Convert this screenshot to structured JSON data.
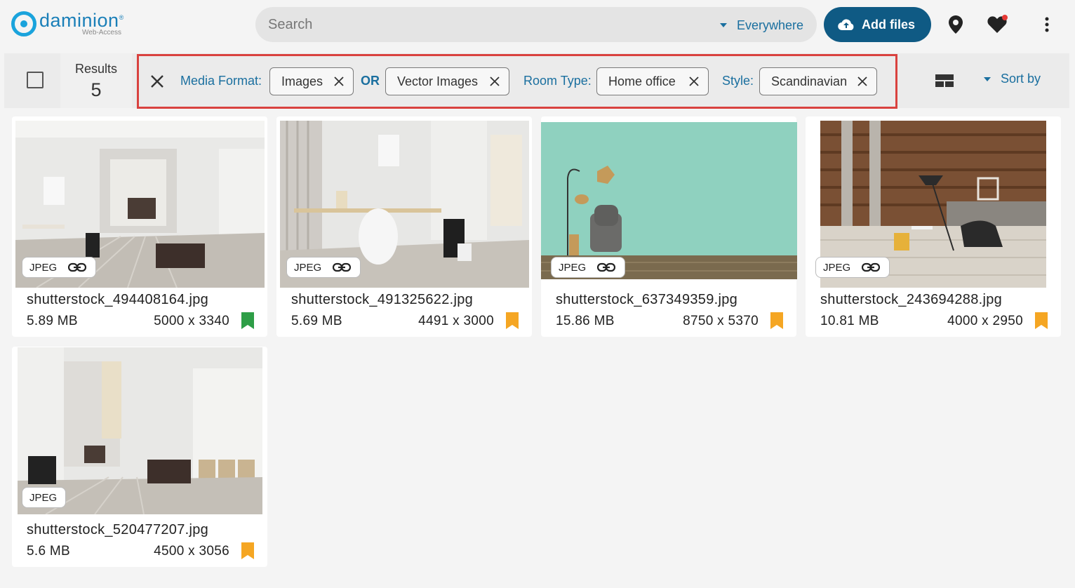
{
  "logo": {
    "name": "daminion",
    "sup": "®",
    "sub": "Web-Access"
  },
  "search": {
    "placeholder": "Search",
    "scope": "Everywhere"
  },
  "header": {
    "add_files": "Add files"
  },
  "toolbar": {
    "results_label": "Results",
    "results_count": "5",
    "sort_label": "Sort by"
  },
  "filters": {
    "media_format_label": "Media Format:",
    "chip1": "Images",
    "or_label": "OR",
    "chip2": "Vector Images",
    "room_type_label": "Room Type:",
    "chip3": "Home office",
    "style_label": "Style:",
    "chip4": "Scandinavian"
  },
  "colors": {
    "accent": "#1a6f9f",
    "primary_button": "#0f5a84",
    "highlight_border": "#d9423f",
    "bookmark_green": "#2e9e47",
    "bookmark_orange": "#f5a623"
  },
  "items": [
    {
      "name": "shutterstock_494408164.jpg",
      "size": "5.89 MB",
      "dims": "5000 x 3340",
      "format": "JPEG",
      "linked": true,
      "bookmark": "green-bookmark-icon"
    },
    {
      "name": "shutterstock_491325622.jpg",
      "size": "5.69 MB",
      "dims": "4491 x 3000",
      "format": "JPEG",
      "linked": true,
      "bookmark": "orange-bookmark-icon"
    },
    {
      "name": "shutterstock_637349359.jpg",
      "size": "15.86 MB",
      "dims": "8750 x 5370",
      "format": "JPEG",
      "linked": true,
      "bookmark": "orange-bookmark-icon"
    },
    {
      "name": "shutterstock_243694288.jpg",
      "size": "10.81 MB",
      "dims": "4000 x 2950",
      "format": "JPEG",
      "linked": true,
      "bookmark": "orange-bookmark-icon"
    },
    {
      "name": "shutterstock_520477207.jpg",
      "size": "5.6 MB",
      "dims": "4500 x 3056",
      "format": "JPEG",
      "linked": false,
      "bookmark": "orange-bookmark-icon"
    }
  ]
}
